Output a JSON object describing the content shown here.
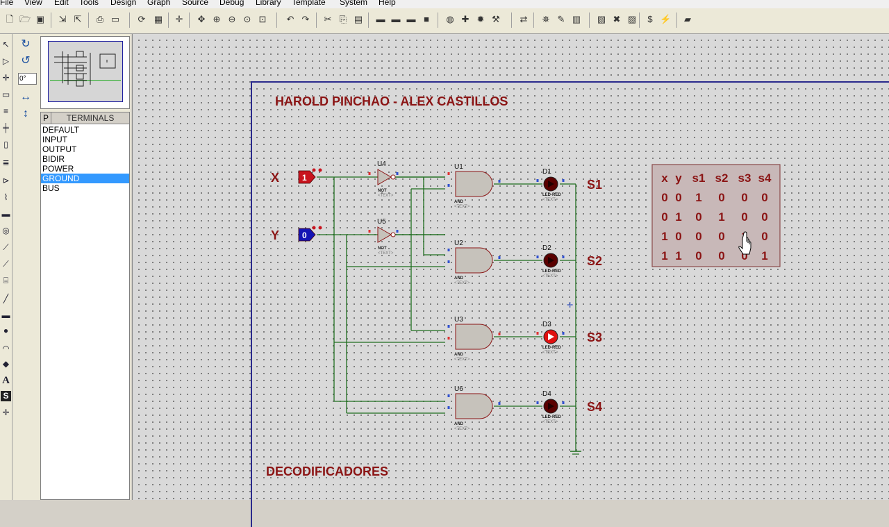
{
  "menu": [
    "File",
    "View",
    "Edit",
    "Tools",
    "Design",
    "Graph",
    "Source",
    "Debug",
    "Library",
    "Template",
    "System",
    "Help"
  ],
  "toolbar_icons": [
    "new-file",
    "open-folder",
    "save",
    "import",
    "export",
    "print",
    "print-area",
    "refresh",
    "grid",
    "origin",
    "pan",
    "zoom-in",
    "zoom-out",
    "zoom-all",
    "zoom-area",
    "undo",
    "redo",
    "cut",
    "copy",
    "paste",
    "block-copy",
    "block-move",
    "block-rotate",
    "block-delete",
    "pick-device",
    "make-device",
    "package",
    "decompose",
    "wire-autorouter",
    "search-tag",
    "property-assign",
    "design-explorer",
    "new-sheet",
    "delete-sheet",
    "goto-sheet",
    "bill-of-materials",
    "electrical-rules-check",
    "ares"
  ],
  "left_tools": [
    "selection-mode",
    "component-mode",
    "junction-dot",
    "wire-label",
    "text-script",
    "buses",
    "subcircuit",
    "terminals",
    "device-pins",
    "graph",
    "tape-recorder",
    "generator",
    "voltage-probe",
    "current-probe",
    "virtual-instruments",
    "line-2d",
    "box-2d",
    "circle-2d",
    "arc-2d",
    "path-2d",
    "text-2d",
    "symbol-2d",
    "marker-2d"
  ],
  "side": {
    "angle": "0°",
    "p_label": "P",
    "title": "TERMINALS",
    "terminals": [
      "DEFAULT",
      "INPUT",
      "OUTPUT",
      "BIDIR",
      "POWER",
      "GROUND",
      "BUS"
    ],
    "selected_index": 5
  },
  "schematic": {
    "title": "HAROLD PINCHAO - ALEX CASTILLOS",
    "footer": "DECODIFICADORES",
    "inputs": [
      {
        "label": "X",
        "state": "1",
        "color": "#c8141e"
      },
      {
        "label": "Y",
        "state": "0",
        "color": "#1414b4"
      }
    ],
    "not_gates": [
      {
        "ref": "U4",
        "type": "NOT",
        "text": "<TEXT>"
      },
      {
        "ref": "U5",
        "type": "NOT",
        "text": "<TEXT>"
      }
    ],
    "and_gates": [
      {
        "ref": "U1",
        "type": "AND",
        "text": "<TEXT>"
      },
      {
        "ref": "U2",
        "type": "AND",
        "text": "<TEXT>"
      },
      {
        "ref": "U3",
        "type": "AND",
        "text": "<TEXT>"
      },
      {
        "ref": "U6",
        "type": "AND",
        "text": "<TEXT>"
      }
    ],
    "leds": [
      {
        "ref": "D1",
        "type": "LED-RED",
        "text": "<TEXT>",
        "lit": false
      },
      {
        "ref": "D2",
        "type": "LED-RED",
        "text": "<TEXT>",
        "lit": false
      },
      {
        "ref": "D3",
        "type": "LED-RED",
        "text": "<TEXT>",
        "lit": true
      },
      {
        "ref": "D4",
        "type": "LED-RED",
        "text": "<TEXT>",
        "lit": false
      }
    ],
    "outputs": [
      "S1",
      "S2",
      "S3",
      "S4"
    ],
    "truth_table": {
      "headers": [
        "x",
        "y",
        "s1",
        "s2",
        "s3",
        "s4"
      ],
      "rows": [
        [
          "0",
          "0",
          "1",
          "0",
          "0",
          "0"
        ],
        [
          "0",
          "1",
          "0",
          "1",
          "0",
          "0"
        ],
        [
          "1",
          "0",
          "0",
          "0",
          "1",
          "0"
        ],
        [
          "1",
          "1",
          "0",
          "0",
          "0",
          "1"
        ]
      ]
    },
    "colors": {
      "wire": "#1e6e1e",
      "label": "#8b1414",
      "gate_fill": "#c6c2bb",
      "gate_stroke": "#8b1414",
      "table_bg": "#c8b8b8",
      "led_off": "#5a0000",
      "led_on": "#e01010"
    }
  }
}
